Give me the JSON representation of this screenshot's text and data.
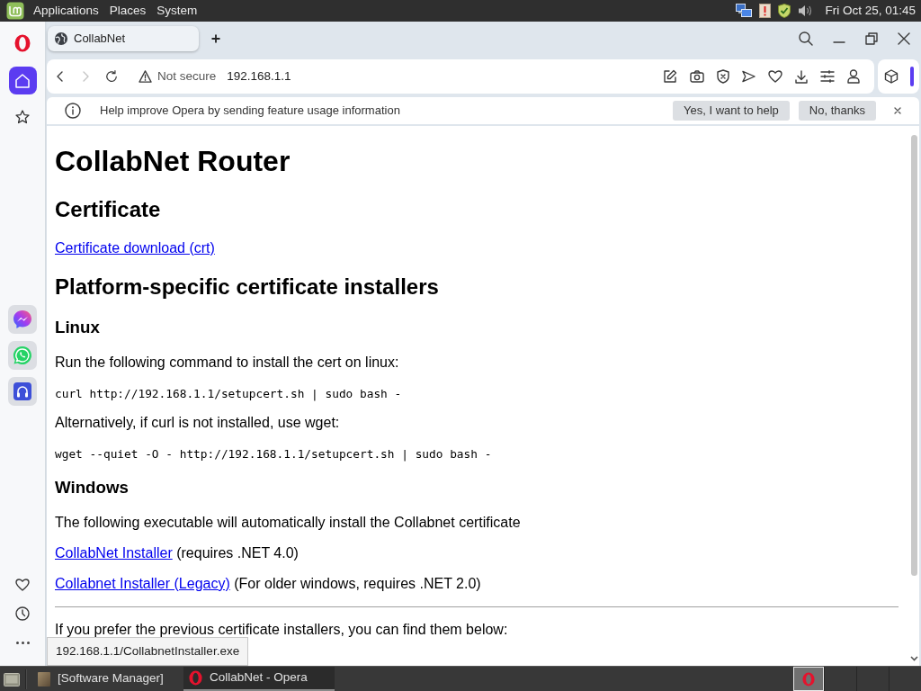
{
  "top_panel": {
    "menus": [
      "Applications",
      "Places",
      "System"
    ],
    "clock": "Fri Oct 25, 01:45"
  },
  "browser": {
    "sidebar": {
      "pages": [
        {
          "selected": true
        },
        {
          "selected": false
        }
      ]
    },
    "tabs": [
      {
        "title": "CollabNet",
        "selected": true
      }
    ],
    "address_bar": {
      "security": "Not secure",
      "url": "192.168.1.1"
    },
    "infobar": {
      "message": "Help improve Opera by sending feature usage information",
      "buttons": [
        "Yes, I want to help",
        "No, thanks"
      ]
    },
    "page": {
      "content": [
        {
          "kind": "h1",
          "text": "CollabNet Router"
        },
        {
          "kind": "h2",
          "text": "Certificate"
        },
        {
          "kind": "link",
          "text": "Certificate download (crt)"
        },
        {
          "kind": "h2",
          "text": "Platform-specific certificate installers"
        },
        {
          "kind": "h3",
          "text": "Linux"
        },
        {
          "kind": "text",
          "text": "Run the following command to install the cert on linux:"
        },
        {
          "kind": "code",
          "text": "curl http://192.168.1.1/setupcert.sh | sudo bash -"
        },
        {
          "kind": "text",
          "text": "Alternatively, if curl is not installed, use wget:"
        },
        {
          "kind": "code",
          "text": "wget --quiet -O - http://192.168.1.1/setupcert.sh | sudo bash -"
        },
        {
          "kind": "h3",
          "text": "Windows"
        },
        {
          "kind": "text",
          "text": "The following executable will automatically install the Collabnet certificate"
        },
        {
          "kind": "link",
          "text": "CollabNet Installer",
          "note": "(requires .NET 4.0)"
        },
        {
          "kind": "link",
          "text": "Collabnet Installer (Legacy)",
          "note": "(For older windows, requires .NET 2.0)"
        },
        {
          "kind": "rule"
        },
        {
          "kind": "text",
          "text": "If you prefer the previous certificate installers, you can find them below:"
        }
      ]
    },
    "status_url": "192.168.1.1/CollabnetInstaller.exe"
  },
  "taskbar": {
    "windows": [
      {
        "title": "[Software Manager]",
        "selected": false
      },
      {
        "title": "CollabNet - Opera",
        "selected": true
      }
    ]
  }
}
